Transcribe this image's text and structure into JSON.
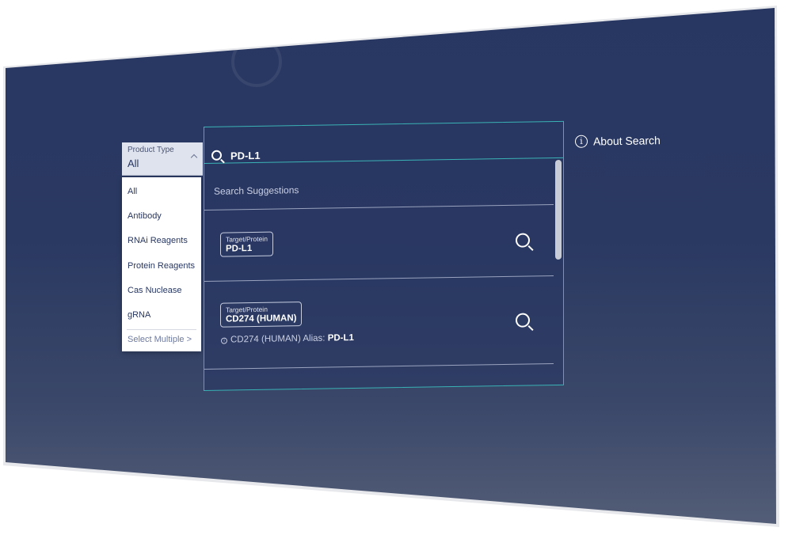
{
  "product_type": {
    "label": "Product Type",
    "value": "All",
    "options": [
      "All",
      "Antibody",
      "RNAi Reagents",
      "Protein Reagents",
      "Cas Nuclease",
      "gRNA"
    ],
    "select_multiple": "Select Multiple >"
  },
  "search": {
    "query": "PD-L1",
    "suggestions_heading": "Search Suggestions",
    "suggestions": [
      {
        "type": "Target/Protein",
        "name": "PD-L1"
      },
      {
        "type": "Target/Protein",
        "name": "CD274 (HUMAN)",
        "alias_prefix": "CD274 (HUMAN) Alias: ",
        "alias_value": "PD-L1"
      }
    ]
  },
  "about_search": "About Search",
  "colors": {
    "background": "#283762",
    "accent": "#3ab3b5",
    "dropdown_bg": "#ffffff"
  },
  "icons": {
    "search": "search-icon",
    "info": "info-icon",
    "chevron": "chevron-up-icon"
  }
}
